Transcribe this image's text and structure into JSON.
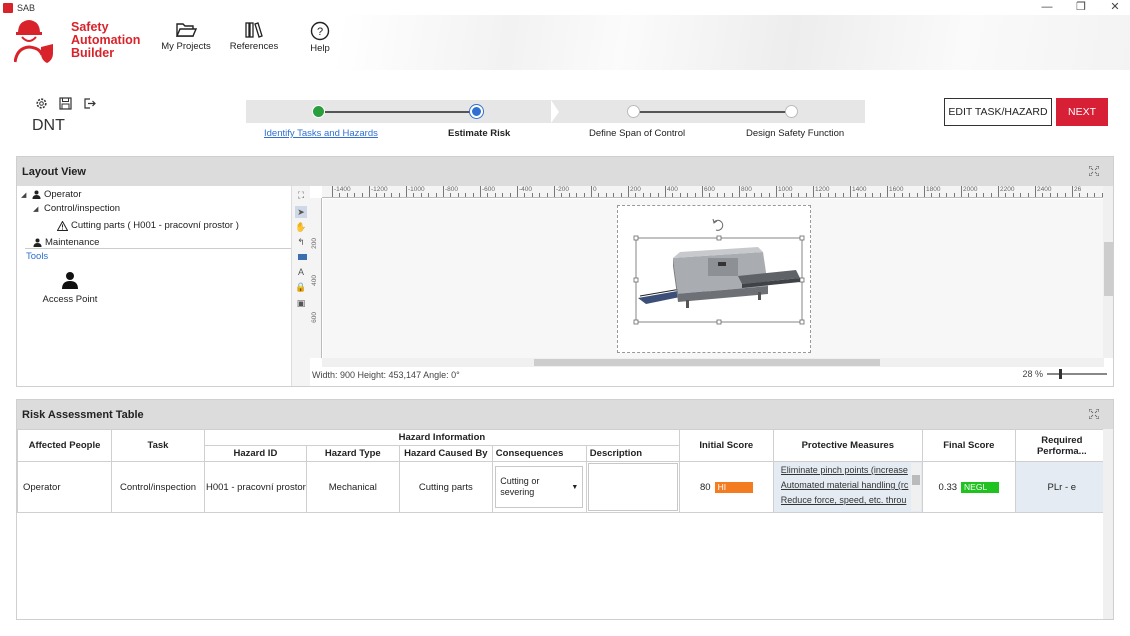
{
  "window": {
    "title": "SAB",
    "minimize": "—",
    "restore": "❐",
    "close": "✕"
  },
  "brand": {
    "line1": "Safety",
    "line2": "Automation",
    "line3": "Builder",
    "color": "#d8232a"
  },
  "nav": [
    {
      "label": "My Projects",
      "icon": "folder-open-icon"
    },
    {
      "label": "References",
      "icon": "books-icon"
    },
    {
      "label": "Help",
      "icon": "help-icon"
    }
  ],
  "project": {
    "code": "DNT"
  },
  "stepper": {
    "steps": [
      {
        "label": "Identify Tasks and Hazards",
        "state": "done"
      },
      {
        "label": "Estimate Risk",
        "state": "current"
      },
      {
        "label": "Define Span of Control",
        "state": "todo"
      },
      {
        "label": "Design Safety Function",
        "state": "todo"
      }
    ]
  },
  "actions": {
    "edit_label": "EDIT TASK/HAZARD",
    "next_label": "NEXT",
    "next_color": "#d71f36"
  },
  "layout_view": {
    "title": "Layout View",
    "tree": {
      "operator": "Operator",
      "control": "Control/inspection",
      "hazard": "Cutting parts ( H001 - pracovní prostor )",
      "maintenance": "Maintenance"
    },
    "tools_label": "Tools",
    "access_point": "Access Point",
    "ruler_h": [
      "-1400",
      "-1200",
      "-1000",
      "-800",
      "-600",
      "-400",
      "-200",
      "0",
      "200",
      "400",
      "600",
      "800",
      "1000",
      "1200",
      "1400",
      "1600",
      "1800",
      "2000",
      "2200",
      "2400",
      "26"
    ],
    "ruler_v": [
      "200",
      "400",
      "600"
    ],
    "status": "Width: 900  Height: 453,147  Angle: 0°",
    "zoom": "28 %"
  },
  "risk_table": {
    "title": "Risk Assessment Table",
    "group_header": "Hazard Information",
    "headers": {
      "affected": "Affected People",
      "task": "Task",
      "hazard_id": "Hazard ID",
      "hazard_type": "Hazard Type",
      "caused_by": "Hazard Caused By",
      "consequences": "Consequences",
      "description": "Description",
      "initial": "Initial Score",
      "measures": "Protective Measures",
      "final": "Final Score",
      "required": "Required Performa..."
    },
    "row": {
      "affected": "Operator",
      "task": "Control/inspection",
      "hazard_id": "H001 - pracovní prostor",
      "hazard_type": "Mechanical",
      "caused_by": "Cutting parts",
      "consequences": "Cutting or severing",
      "description": "",
      "initial_value": "80",
      "initial_badge": "HI",
      "initial_color": "#f47c20",
      "measures": [
        "Eliminate pinch points (increase",
        "Automated material handling (rc",
        "Reduce force, speed, etc. throu"
      ],
      "final_value": "0.33",
      "final_badge": "NEGL",
      "final_color": "#1fc21f",
      "required": "PLr - e"
    }
  }
}
